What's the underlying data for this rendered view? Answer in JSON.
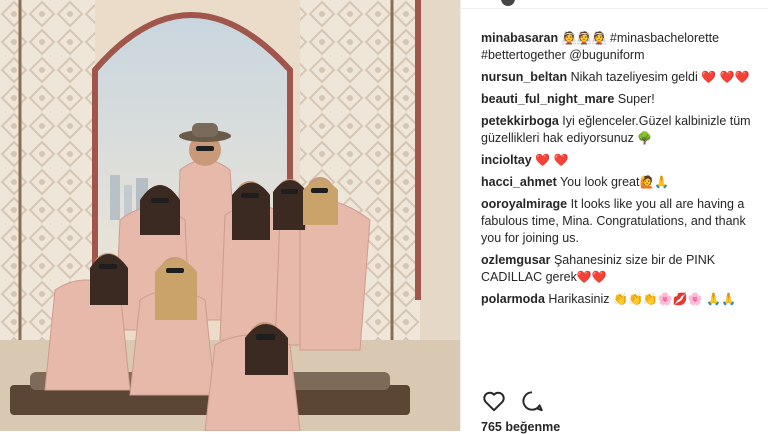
{
  "post": {
    "caption": {
      "user": "minabasaran",
      "emoji": "👰👰👰",
      "text": "#minasbachelorette #bettertogether @buguniform"
    },
    "comments": [
      {
        "user": "nursun_beltan",
        "text": "Nikah tazeliyesim geldi",
        "emoji": "❤️ ❤️❤️"
      },
      {
        "user": "beauti_ful_night_mare",
        "text": "Super!",
        "emoji": ""
      },
      {
        "user": "petekkirboga",
        "text": "Iyi eğlenceler.Güzel kalbinizle tüm güzellikleri hak ediyorsunuz",
        "emoji": "🌳"
      },
      {
        "user": "incioltay",
        "text": "",
        "emoji": "❤️ ❤️"
      },
      {
        "user": "hacci_ahmet",
        "text": "You look great",
        "emoji": "🙋🙏"
      },
      {
        "user": "ooroyalmirage",
        "text": "It looks like you all are having a fabulous time, Mina. Congratulations, and thank you for joining us.",
        "emoji": ""
      },
      {
        "user": "ozlemgusar",
        "text": "Şahanesiniz size bir de PINK CADILLAC gerek",
        "emoji": "❤️❤️"
      },
      {
        "user": "polarmoda",
        "text": "Harikasiniz",
        "emoji": "👏👏👏🌸💋🌸 🙏🙏"
      }
    ],
    "likes_text": "765 beğenme"
  },
  "icons": {
    "like": "heart-icon",
    "comment": "comment-icon"
  },
  "colors": {
    "text": "#262626",
    "divider": "#efefef",
    "robe": "#e6b9aa",
    "lattice": "#e9dfd2"
  }
}
